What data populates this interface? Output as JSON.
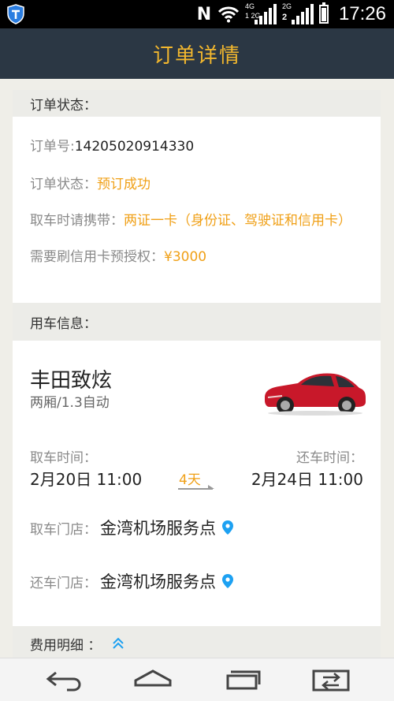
{
  "status_bar": {
    "time": "17:26",
    "nfc": "N",
    "signal1_tag": "4G",
    "signal1_sub": "1 2G",
    "signal2_tag": "2G",
    "signal2_sub": "2"
  },
  "header": {
    "title": "订单详情"
  },
  "order_status_section": {
    "title": "订单状态：",
    "order_no_label": "订单号:",
    "order_no": "14205020914330",
    "status_label": "订单状态：",
    "status_value": "预订成功",
    "carry_label": "取车时请携带：",
    "carry_value": "两证一卡（身份证、驾驶证和信用卡）",
    "preauth_label": "需要刷信用卡预授权：",
    "preauth_value": "¥3000"
  },
  "car_info_section": {
    "title": "用车信息：",
    "car_name": "丰田致炫",
    "car_spec": "两厢/1.3自动",
    "pickup_time_label": "取车时间：",
    "pickup_time": "2月20日 11:00",
    "duration": "4天",
    "return_time_label": "还车时间：",
    "return_time": "2月24日 11:00",
    "pickup_store_label": "取车门店：",
    "pickup_store": "金湾机场服务点",
    "return_store_label": "还车门店：",
    "return_store": "金湾机场服务点"
  },
  "fee_section": {
    "title": "费用明细 ："
  },
  "colors": {
    "accent": "#f0a017",
    "header_bg": "#2b3744",
    "header_text": "#f2b72e",
    "pin": "#1da1f2"
  },
  "icons": {
    "shield": "shield-icon",
    "pin": "location-pin-icon",
    "expand": "double-chevron-up-icon",
    "car": "red-hatchback-car-image",
    "back": "back-arrow-icon",
    "home": "home-icon",
    "recent": "recent-apps-icon",
    "switch": "dual-window-icon"
  }
}
